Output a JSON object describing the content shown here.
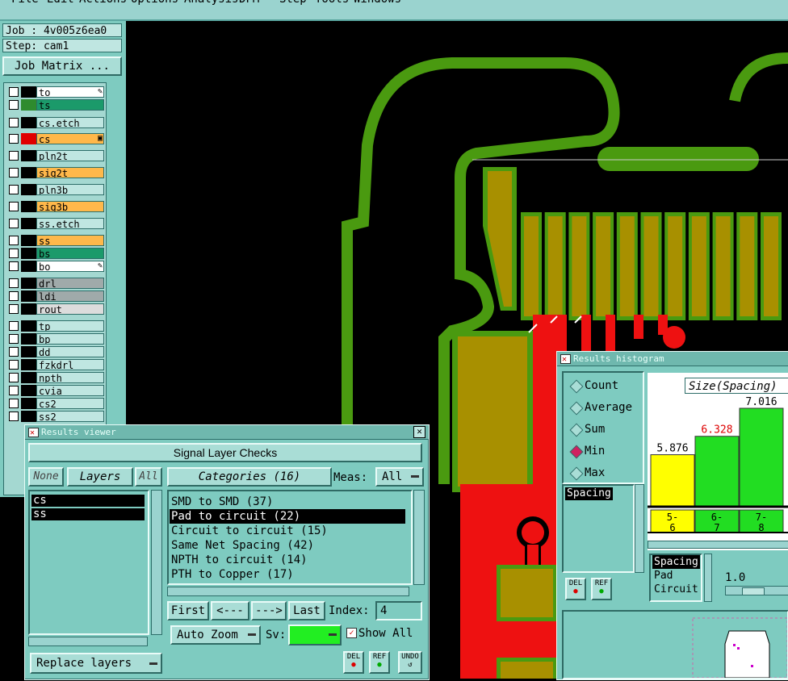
{
  "menu": [
    "File",
    "Edit",
    "Actions",
    "Options",
    "Analysis",
    "DFM",
    "Step",
    "Tools",
    "Windows"
  ],
  "job": {
    "job_label": "Job : 4v005z6ea0",
    "step_label": "Step: cam1",
    "matrix_button": "Job Matrix ..."
  },
  "layers": [
    {
      "name": "to",
      "color": "#ffffff",
      "swatch": "#000000",
      "mark": "✎"
    },
    {
      "name": "ts",
      "color": "#1b9a6a",
      "swatch": "#2e8b2e",
      "mark": ""
    },
    {
      "name": "cs.etch",
      "color": "#bfe6e1",
      "swatch": "#000000",
      "mark": ""
    },
    {
      "name": "cs",
      "color": "#ffb84a",
      "swatch": "#e00000",
      "mark": "▣"
    },
    {
      "name": "pln2t",
      "color": "#bfe6e1",
      "swatch": "#000000",
      "mark": ""
    },
    {
      "name": "sig2t",
      "color": "#ffb84a",
      "swatch": "#000000",
      "mark": ""
    },
    {
      "name": "pln3b",
      "color": "#bfe6e1",
      "swatch": "#000000",
      "mark": ""
    },
    {
      "name": "sig3b",
      "color": "#ffb84a",
      "swatch": "#000000",
      "mark": ""
    },
    {
      "name": "ss.etch",
      "color": "#bfe6e1",
      "swatch": "#000000",
      "mark": ""
    },
    {
      "name": "ss",
      "color": "#ffb84a",
      "swatch": "#000000",
      "mark": ""
    },
    {
      "name": "bs",
      "color": "#1b9a6a",
      "swatch": "#000000",
      "mark": ""
    },
    {
      "name": "bo",
      "color": "#ffffff",
      "swatch": "#000000",
      "mark": "✎"
    },
    {
      "name": "drl",
      "color": "#a0aaaa",
      "swatch": "#000000",
      "mark": ""
    },
    {
      "name": "ldi",
      "color": "#a0aaaa",
      "swatch": "#000000",
      "mark": ""
    },
    {
      "name": "rout",
      "color": "#dcdcdc",
      "swatch": "#000000",
      "mark": ""
    },
    {
      "name": "tp",
      "color": "#bfe6e1",
      "swatch": "#000000",
      "mark": ""
    },
    {
      "name": "bp",
      "color": "#bfe6e1",
      "swatch": "#000000",
      "mark": ""
    },
    {
      "name": "dd",
      "color": "#bfe6e1",
      "swatch": "#000000",
      "mark": ""
    },
    {
      "name": "fzkdrl",
      "color": "#bfe6e1",
      "swatch": "#000000",
      "mark": ""
    },
    {
      "name": "npth",
      "color": "#bfe6e1",
      "swatch": "#000000",
      "mark": ""
    },
    {
      "name": "cvia",
      "color": "#bfe6e1",
      "swatch": "#000000",
      "mark": ""
    },
    {
      "name": "cs2",
      "color": "#bfe6e1",
      "swatch": "#000000",
      "mark": ""
    },
    {
      "name": "ss2",
      "color": "#bfe6e1",
      "swatch": "#000000",
      "mark": ""
    }
  ],
  "results_viewer": {
    "title": "Results viewer",
    "header": "Signal Layer Checks",
    "none_label": "None",
    "layers_label": "Layers",
    "all_label": "All",
    "categories_label": "Categories (16)",
    "meas_label": "Meas:",
    "meas_value": "All",
    "layer_items": [
      "cs",
      "ss"
    ],
    "categories": [
      "SMD to SMD (37)",
      "Pad to circuit (22)",
      "Circuit to circuit (15)",
      "Same Net Spacing (42)",
      "NPTH to circuit (14)",
      "PTH to Copper (17)"
    ],
    "selected_category": 1,
    "first_label": "First",
    "prev_label": "<---",
    "next_label": "--->",
    "last_label": "Last",
    "index_label": "Index:",
    "index_value": "4",
    "auto_zoom_label": "Auto Zoom",
    "sv_label": "Sv:",
    "show_all_label": "Show All",
    "replace_layers_label": "Replace layers",
    "del_label": "DEL",
    "ref_label": "REF",
    "undo_label": "UNDO"
  },
  "histogram": {
    "title": "Results histogram",
    "radios": [
      "Count",
      "Average",
      "Sum",
      "Min",
      "Max"
    ],
    "selected_radio": "Min",
    "size_label": "Size(Spacing)",
    "list_top": [
      "Spacing"
    ],
    "list_bottom": [
      "Spacing",
      "Pad",
      "Circuit"
    ],
    "slider_value": "1.0",
    "del_label": "DEL",
    "ref_label": "REF",
    "bars": [
      {
        "value": "5.876",
        "label": "5-\n6",
        "color": "#ffff00",
        "value_color": "#000000"
      },
      {
        "value": "6.328",
        "label": "6-\n7",
        "color": "#22dd22",
        "value_color": "#dd0000"
      },
      {
        "value": "7.016",
        "label": "7-\n8",
        "color": "#22dd22",
        "value_color": "#000000"
      }
    ]
  }
}
